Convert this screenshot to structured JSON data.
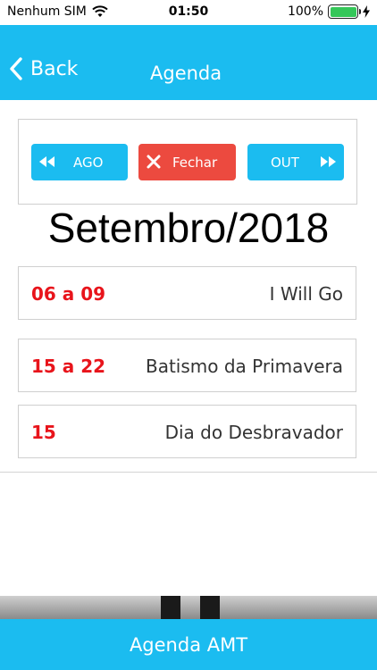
{
  "status_bar": {
    "carrier": "Nenhum SIM",
    "time": "01:50",
    "battery": "100%"
  },
  "nav": {
    "back_label": "Back",
    "title": "Agenda"
  },
  "controls": {
    "prev_label": "AGO",
    "close_label": "Fechar",
    "next_label": "OUT"
  },
  "month": "Setembro/2018",
  "events": [
    {
      "date": "06 a 09",
      "title": "I Will Go"
    },
    {
      "date": "15 a 22",
      "title": "Batismo da Primavera"
    },
    {
      "date": "15",
      "title": "Dia do Desbravador"
    }
  ],
  "bottom_bar": {
    "label": "Agenda AMT"
  },
  "colors": {
    "accent": "#1bbcf0",
    "close": "#ec4a3f",
    "date": "#e8141b"
  }
}
